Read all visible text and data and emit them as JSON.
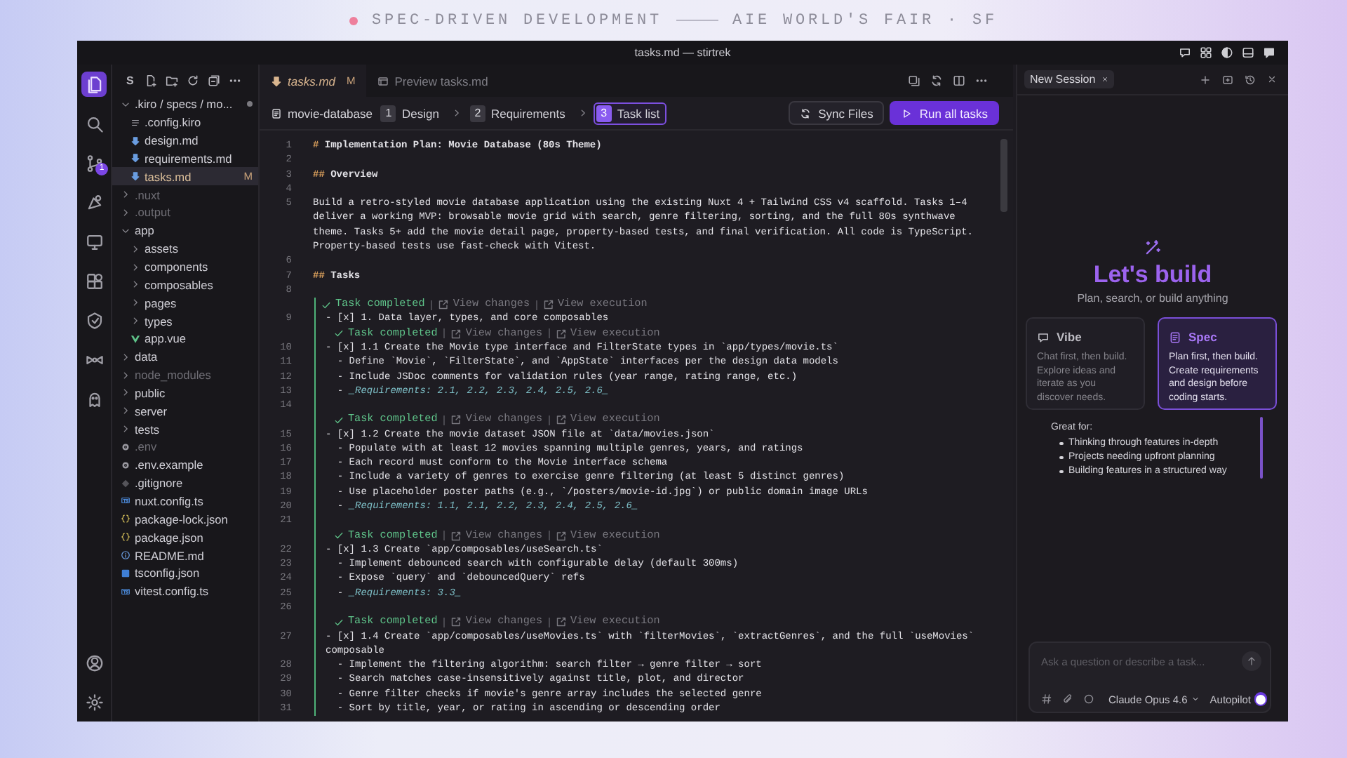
{
  "banner": {
    "left": "SPEC-DRIVEN DEVELOPMENT",
    "right": "AIE WORLD'S FAIR · SF"
  },
  "window": {
    "title": "tasks.md — stirtrek"
  },
  "activity_bar": {
    "items": [
      {
        "selected": true
      },
      {
        "selected": false
      },
      {
        "selected": false,
        "badge": "1"
      },
      {
        "selected": false
      },
      {
        "selected": false
      },
      {
        "selected": false
      },
      {
        "selected": false
      },
      {
        "selected": false
      },
      {
        "selected": false
      }
    ]
  },
  "explorer": {
    "title": "S",
    "tree": [
      {
        "name": ".kiro / specs / mo...",
        "kind": "folder",
        "expanded": true,
        "selected": false,
        "dimmed": false,
        "modified": true,
        "children": [
          {
            "name": ".config.kiro",
            "kind": "config",
            "selected": false,
            "dimmed": false,
            "modified": false
          },
          {
            "name": "design.md",
            "kind": "markdown",
            "selected": false,
            "dimmed": false,
            "modified": false
          },
          {
            "name": "requirements.md",
            "kind": "markdown",
            "selected": false,
            "dimmed": false,
            "modified": false
          },
          {
            "name": "tasks.md",
            "kind": "markdown",
            "selected": true,
            "dimmed": false,
            "modified": true,
            "badge": "M"
          }
        ]
      },
      {
        "name": ".nuxt",
        "kind": "folder",
        "expanded": false,
        "selected": false,
        "dimmed": true,
        "modified": false
      },
      {
        "name": ".output",
        "kind": "folder",
        "expanded": false,
        "selected": false,
        "dimmed": true,
        "modified": false
      },
      {
        "name": "app",
        "kind": "folder",
        "expanded": true,
        "selected": false,
        "dimmed": false,
        "modified": false,
        "children": [
          {
            "name": "assets",
            "kind": "folder",
            "expanded": false,
            "selected": false,
            "dimmed": false,
            "modified": false
          },
          {
            "name": "components",
            "kind": "folder",
            "expanded": false,
            "selected": false,
            "dimmed": false,
            "modified": false
          },
          {
            "name": "composables",
            "kind": "folder",
            "expanded": false,
            "selected": false,
            "dimmed": false,
            "modified": false
          },
          {
            "name": "pages",
            "kind": "folder",
            "expanded": false,
            "selected": false,
            "dimmed": false,
            "modified": false
          },
          {
            "name": "types",
            "kind": "folder",
            "expanded": false,
            "selected": false,
            "dimmed": false,
            "modified": false
          },
          {
            "name": "app.vue",
            "kind": "vue",
            "selected": false,
            "dimmed": false,
            "modified": false
          }
        ]
      },
      {
        "name": "data",
        "kind": "folder",
        "expanded": false,
        "selected": false,
        "dimmed": false,
        "modified": false
      },
      {
        "name": "node_modules",
        "kind": "folder",
        "expanded": false,
        "selected": false,
        "dimmed": true,
        "modified": false
      },
      {
        "name": "public",
        "kind": "folder",
        "expanded": false,
        "selected": false,
        "dimmed": false,
        "modified": false
      },
      {
        "name": "server",
        "kind": "folder",
        "expanded": false,
        "selected": false,
        "dimmed": false,
        "modified": false
      },
      {
        "name": "tests",
        "kind": "folder",
        "expanded": false,
        "selected": false,
        "dimmed": false,
        "modified": false
      },
      {
        "name": ".env",
        "kind": "env",
        "selected": false,
        "dimmed": true,
        "modified": false
      },
      {
        "name": ".env.example",
        "kind": "env",
        "selected": false,
        "dimmed": false,
        "modified": false
      },
      {
        "name": ".gitignore",
        "kind": "git",
        "selected": false,
        "dimmed": false,
        "modified": false
      },
      {
        "name": "nuxt.config.ts",
        "kind": "ts",
        "selected": false,
        "dimmed": false,
        "modified": false
      },
      {
        "name": "package-lock.json",
        "kind": "json",
        "selected": false,
        "dimmed": false,
        "modified": false
      },
      {
        "name": "package.json",
        "kind": "json",
        "selected": false,
        "dimmed": false,
        "modified": false
      },
      {
        "name": "README.md",
        "kind": "info",
        "selected": false,
        "dimmed": false,
        "modified": false
      },
      {
        "name": "tsconfig.json",
        "kind": "tsconfig",
        "selected": false,
        "dimmed": false,
        "modified": false
      },
      {
        "name": "vitest.config.ts",
        "kind": "ts",
        "selected": false,
        "dimmed": false,
        "modified": false
      }
    ]
  },
  "editor": {
    "tabs": [
      {
        "label": "tasks.md",
        "badge": "M",
        "kind": "markdown",
        "selected": true
      },
      {
        "label": "Preview tasks.md",
        "kind": "preview",
        "selected": false
      }
    ],
    "breadcrumb": {
      "spec": "movie-database",
      "steps": [
        {
          "number": "1",
          "label": "Design",
          "selected": false
        },
        {
          "number": "2",
          "label": "Requirements",
          "selected": false
        },
        {
          "number": "3",
          "label": "Task list",
          "selected": true
        }
      ]
    },
    "actions": [
      {
        "label": "Sync Files",
        "kind": "secondary"
      },
      {
        "label": "Run all tasks",
        "kind": "primary"
      }
    ],
    "lines": [
      {
        "num": "1",
        "kind": "heading",
        "marker": "#",
        "text": "Implementation Plan: Movie Database (80s Theme)"
      },
      {
        "num": "2",
        "kind": "blank"
      },
      {
        "num": "3",
        "kind": "heading",
        "marker": "##",
        "text": "Overview"
      },
      {
        "num": "4",
        "kind": "blank"
      },
      {
        "num": "5",
        "kind": "text",
        "text": "Build a retro-styled movie database application using the existing Nuxt 4 + Tailwind CSS v4 scaffold. Tasks 1–4 deliver a working MVP: browsable movie grid with search, genre filtering, sorting, and the full 80s synthwave theme. Tasks 5+ add the movie detail page, property-based tests, and final verification. All code is TypeScript. Property-based tests use fast-check with Vitest."
      },
      {
        "num": "6",
        "kind": "blank"
      },
      {
        "num": "7",
        "kind": "heading",
        "marker": "##",
        "text": "Tasks"
      },
      {
        "num": "8",
        "kind": "blank"
      }
    ],
    "task_section": {
      "tasks": [
        {
          "lens": {
            "status": "Task completed",
            "changes": "View changes",
            "execution": "View execution"
          },
          "num": "9",
          "text": "- [x] 1. Data layer, types, and core composables",
          "children": [
            {
              "lens": {
                "status": "Task completed",
                "changes": "View changes",
                "execution": "View execution"
              },
              "num": "10",
              "text": "- [x] 1.1 Create the Movie type interface and FilterState types in `app/types/movie.ts`",
              "details": [
                {
                  "num": "11",
                  "kind": "item",
                  "text": "- Define `Movie`, `FilterState`, and `AppState` interfaces per the design data models"
                },
                {
                  "num": "12",
                  "kind": "item",
                  "text": "- Include JSDoc comments for validation rules (year range, rating range, etc.)"
                },
                {
                  "num": "13",
                  "kind": "req",
                  "bullet": "-",
                  "text": "_Requirements: 2.1, 2.2, 2.3, 2.4, 2.5, 2.6_"
                },
                {
                  "num": "14",
                  "kind": "blank"
                }
              ]
            },
            {
              "lens": {
                "status": "Task completed",
                "changes": "View changes",
                "execution": "View execution"
              },
              "num": "15",
              "text": "- [x] 1.2 Create the movie dataset JSON file at `data/movies.json`",
              "details": [
                {
                  "num": "16",
                  "kind": "item",
                  "text": "- Populate with at least 12 movies spanning multiple genres, years, and ratings"
                },
                {
                  "num": "17",
                  "kind": "item",
                  "text": "- Each record must conform to the Movie interface schema"
                },
                {
                  "num": "18",
                  "kind": "item",
                  "text": "- Include a variety of genres to exercise genre filtering (at least 5 distinct genres)"
                },
                {
                  "num": "19",
                  "kind": "item",
                  "text": "- Use placeholder poster paths (e.g., `/posters/movie-id.jpg`) or public domain image URLs"
                },
                {
                  "num": "20",
                  "kind": "req",
                  "bullet": "-",
                  "text": "_Requirements: 1.1, 2.1, 2.2, 2.3, 2.4, 2.5, 2.6_"
                },
                {
                  "num": "21",
                  "kind": "blank"
                }
              ]
            },
            {
              "lens": {
                "status": "Task completed",
                "changes": "View changes",
                "execution": "View execution"
              },
              "num": "22",
              "text": "- [x] 1.3 Create `app/composables/useSearch.ts`",
              "details": [
                {
                  "num": "23",
                  "kind": "item",
                  "text": "- Implement debounced search with configurable delay (default 300ms)"
                },
                {
                  "num": "24",
                  "kind": "item",
                  "text": "- Expose `query` and `debouncedQuery` refs"
                },
                {
                  "num": "25",
                  "kind": "req",
                  "bullet": "-",
                  "text": "_Requirements: 3.3_"
                },
                {
                  "num": "26",
                  "kind": "blank"
                }
              ]
            },
            {
              "lens": {
                "status": "Task completed",
                "changes": "View changes",
                "execution": "View execution"
              },
              "num": "27",
              "text": "- [x] 1.4 Create `app/composables/useMovies.ts` with `filterMovies`, `extractGenres`, and the full `useMovies` composable",
              "details": [
                {
                  "num": "28",
                  "kind": "item",
                  "text": "- Implement the filtering algorithm: search filter → genre filter → sort"
                },
                {
                  "num": "29",
                  "kind": "item",
                  "text": "- Search matches case-insensitively against title, plot, and director"
                },
                {
                  "num": "30",
                  "kind": "item",
                  "text": "- Genre filter checks if movie's genre array includes the selected genre"
                },
                {
                  "num": "31",
                  "kind": "item",
                  "text": "- Sort by title, year, or rating in ascending or descending order"
                }
              ]
            }
          ]
        }
      ]
    }
  },
  "session": {
    "tab": "New Session",
    "title": "Let's build",
    "subtitle": "Plan, search, or build anything",
    "modes": [
      {
        "name": "Vibe",
        "kind": "chat",
        "description": "Chat first, then build. Explore ideas and iterate as you discover needs.",
        "selected": false
      },
      {
        "name": "Spec",
        "kind": "spec",
        "description": "Plan first, then build. Create requirements and design before coding starts.",
        "selected": true
      }
    ],
    "great_for": {
      "label": "Great for:",
      "items": [
        "Thinking through features in-depth",
        "Projects needing upfront planning",
        "Building features in a structured way"
      ]
    },
    "composer": {
      "placeholder": "Ask a question or describe a task...",
      "model": "Claude Opus 4.6",
      "autopilot": {
        "label": "Autopilot",
        "on": true
      }
    }
  }
}
